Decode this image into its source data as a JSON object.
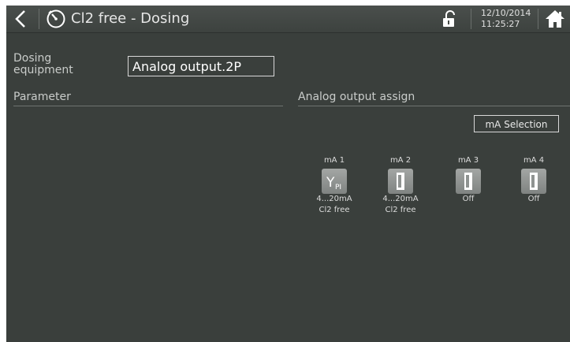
{
  "header": {
    "title": "Cl2 free - Dosing",
    "date": "12/10/2014",
    "time": "11:25:27"
  },
  "dosing": {
    "label_line1": "Dosing",
    "label_line2": "equipment",
    "value": "Analog output.2P"
  },
  "sections": {
    "parameter": "Parameter",
    "analog_output_assign": "Analog output assign"
  },
  "ma_selection_label": "mA Selection",
  "outputs": [
    {
      "name": "mA 1",
      "icon": "y-pi-controller-icon",
      "line1": "4...20mA",
      "line2": "Cl2 free"
    },
    {
      "name": "mA 2",
      "icon": "output-switch-icon",
      "line1": "4...20mA",
      "line2": "Cl2 free"
    },
    {
      "name": "mA 3",
      "icon": "output-switch-icon",
      "line1": "Off",
      "line2": ""
    },
    {
      "name": "mA 4",
      "icon": "output-switch-icon",
      "line1": "Off",
      "line2": ""
    }
  ],
  "icons": {
    "back": "back-arrow-icon",
    "menu": "clock-dial-icon",
    "lock": "unlocked-padlock-icon",
    "home": "home-icon"
  },
  "colors": {
    "background": "#3a3f3c",
    "text": "#c9ccca",
    "header": "#454a47"
  }
}
